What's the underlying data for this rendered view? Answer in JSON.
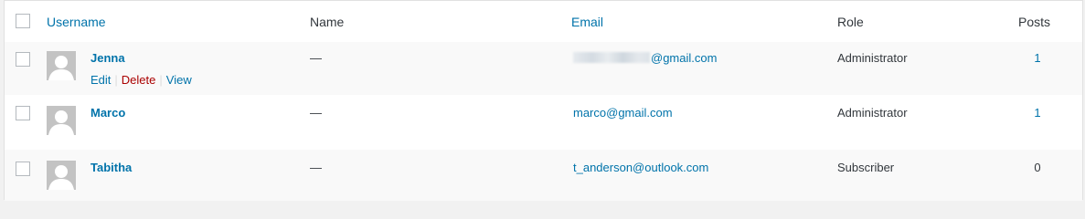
{
  "columns": {
    "username": "Username",
    "name": "Name",
    "email": "Email",
    "role": "Role",
    "posts": "Posts"
  },
  "rows": [
    {
      "username": "Jenna",
      "name": "—",
      "email_visible": "@gmail.com",
      "email_redacted": true,
      "role": "Administrator",
      "posts": "1",
      "actions": {
        "edit": "Edit",
        "delete": "Delete",
        "view": "View"
      }
    },
    {
      "username": "Marco",
      "name": "—",
      "email": "marco@gmail.com",
      "role": "Administrator",
      "posts": "1"
    },
    {
      "username": "Tabitha",
      "name": "—",
      "email": "t_anderson@outlook.com",
      "role": "Subscriber",
      "posts": "0"
    }
  ],
  "colors": {
    "link": "#0073aa",
    "delete": "#aa0000",
    "alt_row": "#f9f9f9",
    "avatar": "#c3c3c3"
  },
  "icons": {
    "avatar": "default-avatar-silhouette-icon"
  }
}
